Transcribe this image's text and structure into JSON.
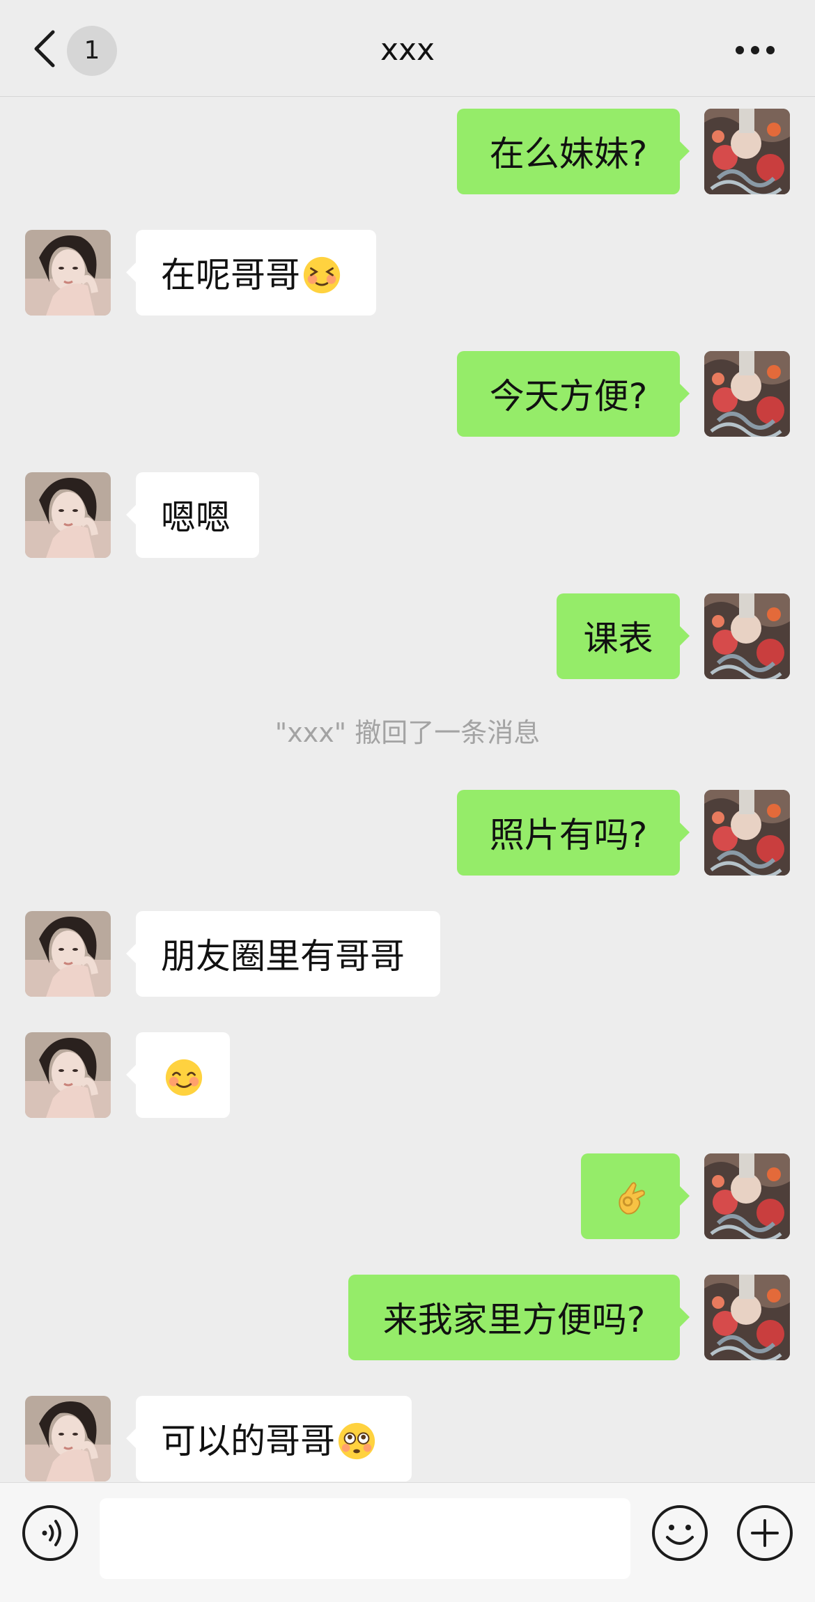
{
  "header": {
    "unread_count": "1",
    "title": "xxx"
  },
  "messages": [
    {
      "sender": "me",
      "text": "在么妹妹?"
    },
    {
      "sender": "them",
      "text": "在呢哥哥",
      "emoji": "squinting-grin-emoji"
    },
    {
      "sender": "me",
      "text": "今天方便?"
    },
    {
      "sender": "them",
      "text": "嗯嗯"
    },
    {
      "sender": "me",
      "text": "课表"
    },
    {
      "sender": "system",
      "text": "\"xxx\" 撤回了一条消息"
    },
    {
      "sender": "me",
      "text": "照片有吗?"
    },
    {
      "sender": "them",
      "text": "朋友圈里有哥哥"
    },
    {
      "sender": "them",
      "text": "",
      "emoji": "blushing-smile-emoji"
    },
    {
      "sender": "me",
      "text": "",
      "emoji": "ok-hand-emoji"
    },
    {
      "sender": "me",
      "text": "来我家里方便吗?"
    },
    {
      "sender": "them",
      "text": "可以的哥哥",
      "emoji": "flushed-emoji"
    }
  ],
  "input": {
    "value": "",
    "placeholder": ""
  },
  "colors": {
    "background": "#ededed",
    "my_bubble": "#95ec69",
    "their_bubble": "#ffffff",
    "system_text": "#a3a3a3"
  }
}
